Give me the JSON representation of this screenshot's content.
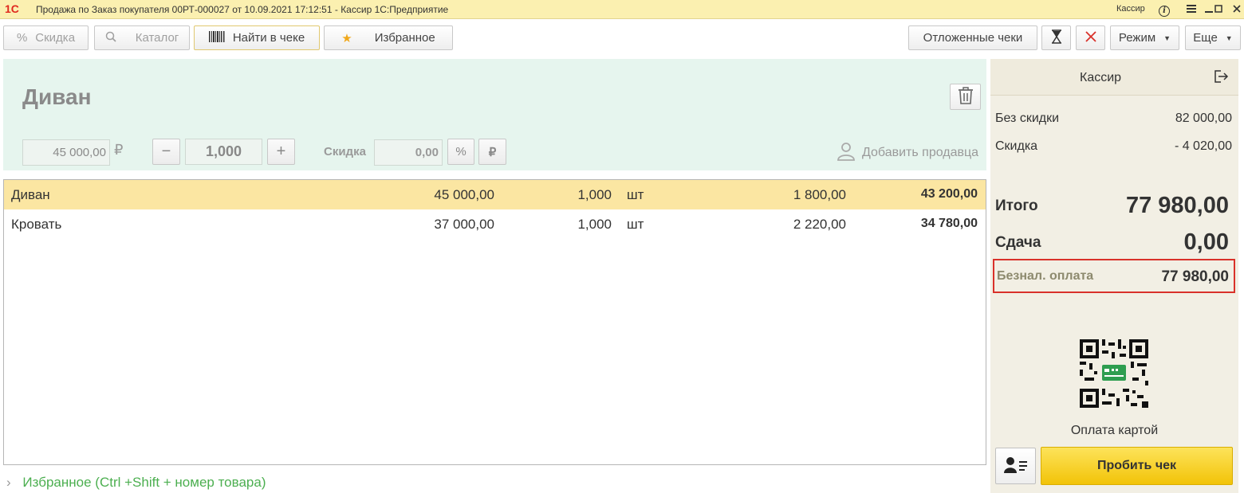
{
  "window": {
    "logo": "1С",
    "title": "Продажа по Заказ покупателя 00РТ-000027 от 10.09.2021 17:12:51 - Кассир 1С:Предприятие",
    "user": "Кассир"
  },
  "toolbar": {
    "discount_label": "Скидка",
    "catalog_label": "Каталог",
    "find_in_check_label": "Найти в чеке",
    "favorites_label": "Избранное",
    "deferred_checks_label": "Отложенные чеки",
    "mode_label": "Режим",
    "more_label": "Еще"
  },
  "current_item": {
    "name": "Диван",
    "price": "45 000,00",
    "currency": "₽",
    "quantity": "1,000",
    "discount_label": "Скидка",
    "discount_value": "0,00",
    "percent_symbol": "%",
    "ruble_symbol": "₽",
    "add_seller_label": "Добавить продавца"
  },
  "items": [
    {
      "name": "Диван",
      "price": "45 000,00",
      "quantity": "1,000",
      "unit": "шт",
      "discount": "1 800,00",
      "total": "43 200,00",
      "selected": true
    },
    {
      "name": "Кровать",
      "price": "37 000,00",
      "quantity": "1,000",
      "unit": "шт",
      "discount": "2 220,00",
      "total": "34 780,00",
      "selected": false
    }
  ],
  "favorites_footer": "Избранное (Ctrl +Shift + номер товара)",
  "summary": {
    "cashier_label": "Кассир",
    "without_discount_label": "Без скидки",
    "without_discount_value": "82 000,00",
    "discount_label": "Скидка",
    "discount_value": "- 4 020,00",
    "total_label": "Итого",
    "total_value": "77 980,00",
    "change_label": "Сдача",
    "change_value": "0,00",
    "cashless_label": "Безнал. оплата",
    "cashless_value": "77 980,00",
    "card_payment_label": "Оплата картой",
    "print_check_label": "Пробить чек"
  },
  "colors": {
    "title_bar": "#fbf0b0",
    "item_panel": "#e6f5ee",
    "selected_row": "#fbe6a2",
    "right_panel": "#f2efe4",
    "print_button": "#f7d225",
    "highlight_border": "#d9312a",
    "favorites_text": "#4caf50"
  }
}
